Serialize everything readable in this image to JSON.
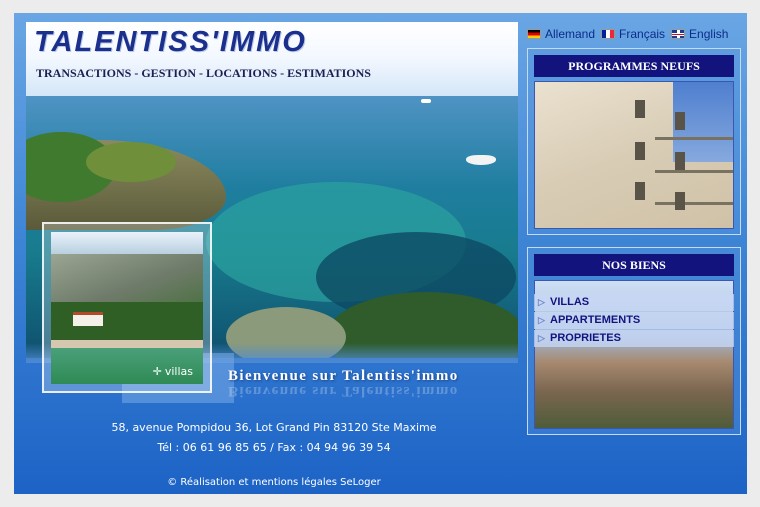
{
  "header": {
    "logo": "TALENTISS'IMMO",
    "tagline": "TRANSACTIONS - GESTION - LOCATIONS - ESTIMATIONS"
  },
  "languages": [
    {
      "label": "Allemand",
      "flag": "de-flag"
    },
    {
      "label": "Français",
      "flag": "fr-flag"
    },
    {
      "label": "English",
      "flag": "uk-flag"
    }
  ],
  "hero": {
    "thumbnail_label": "villas",
    "welcome": "Bienvenue sur Talentiss'immo"
  },
  "panels": {
    "programmes_title": "PROGRAMMES NEUFS",
    "biens_title": "NOS BIENS",
    "biens_items": [
      "VILLAS",
      "APPARTEMENTS",
      "PROPRIETES"
    ]
  },
  "footer": {
    "address": "58, avenue Pompidou 36, Lot Grand Pin 83120 Ste Maxime",
    "phone": "Tél : 06 61 96 85 65 / Fax : 04 94 96 39 54",
    "credits": "© Réalisation  et mentions légales SeLoger"
  },
  "colors": {
    "navy": "#12137d",
    "logo_blue": "#1b2f8c",
    "background_blue": "#1d63c6"
  }
}
